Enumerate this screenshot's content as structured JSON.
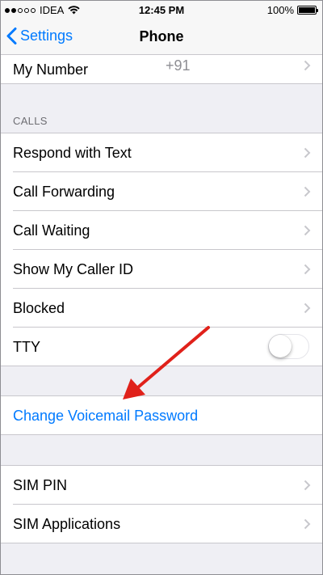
{
  "status_bar": {
    "carrier": "IDEA",
    "time": "12:45 PM",
    "battery": "100%"
  },
  "nav": {
    "back_label": "Settings",
    "title": "Phone"
  },
  "my_number": {
    "label": "My Number",
    "value": "+91"
  },
  "calls_section": {
    "header": "CALLS",
    "items": [
      {
        "label": "Respond with Text"
      },
      {
        "label": "Call Forwarding"
      },
      {
        "label": "Call Waiting"
      },
      {
        "label": "Show My Caller ID"
      },
      {
        "label": "Blocked"
      },
      {
        "label": "TTY",
        "toggle": false
      }
    ]
  },
  "voicemail": {
    "label": "Change Voicemail Password"
  },
  "sim_section": {
    "items": [
      {
        "label": "SIM PIN"
      },
      {
        "label": "SIM Applications"
      }
    ]
  },
  "colors": {
    "accent": "#007aff",
    "annotation_arrow": "#e0211a",
    "background": "#efeff4"
  }
}
